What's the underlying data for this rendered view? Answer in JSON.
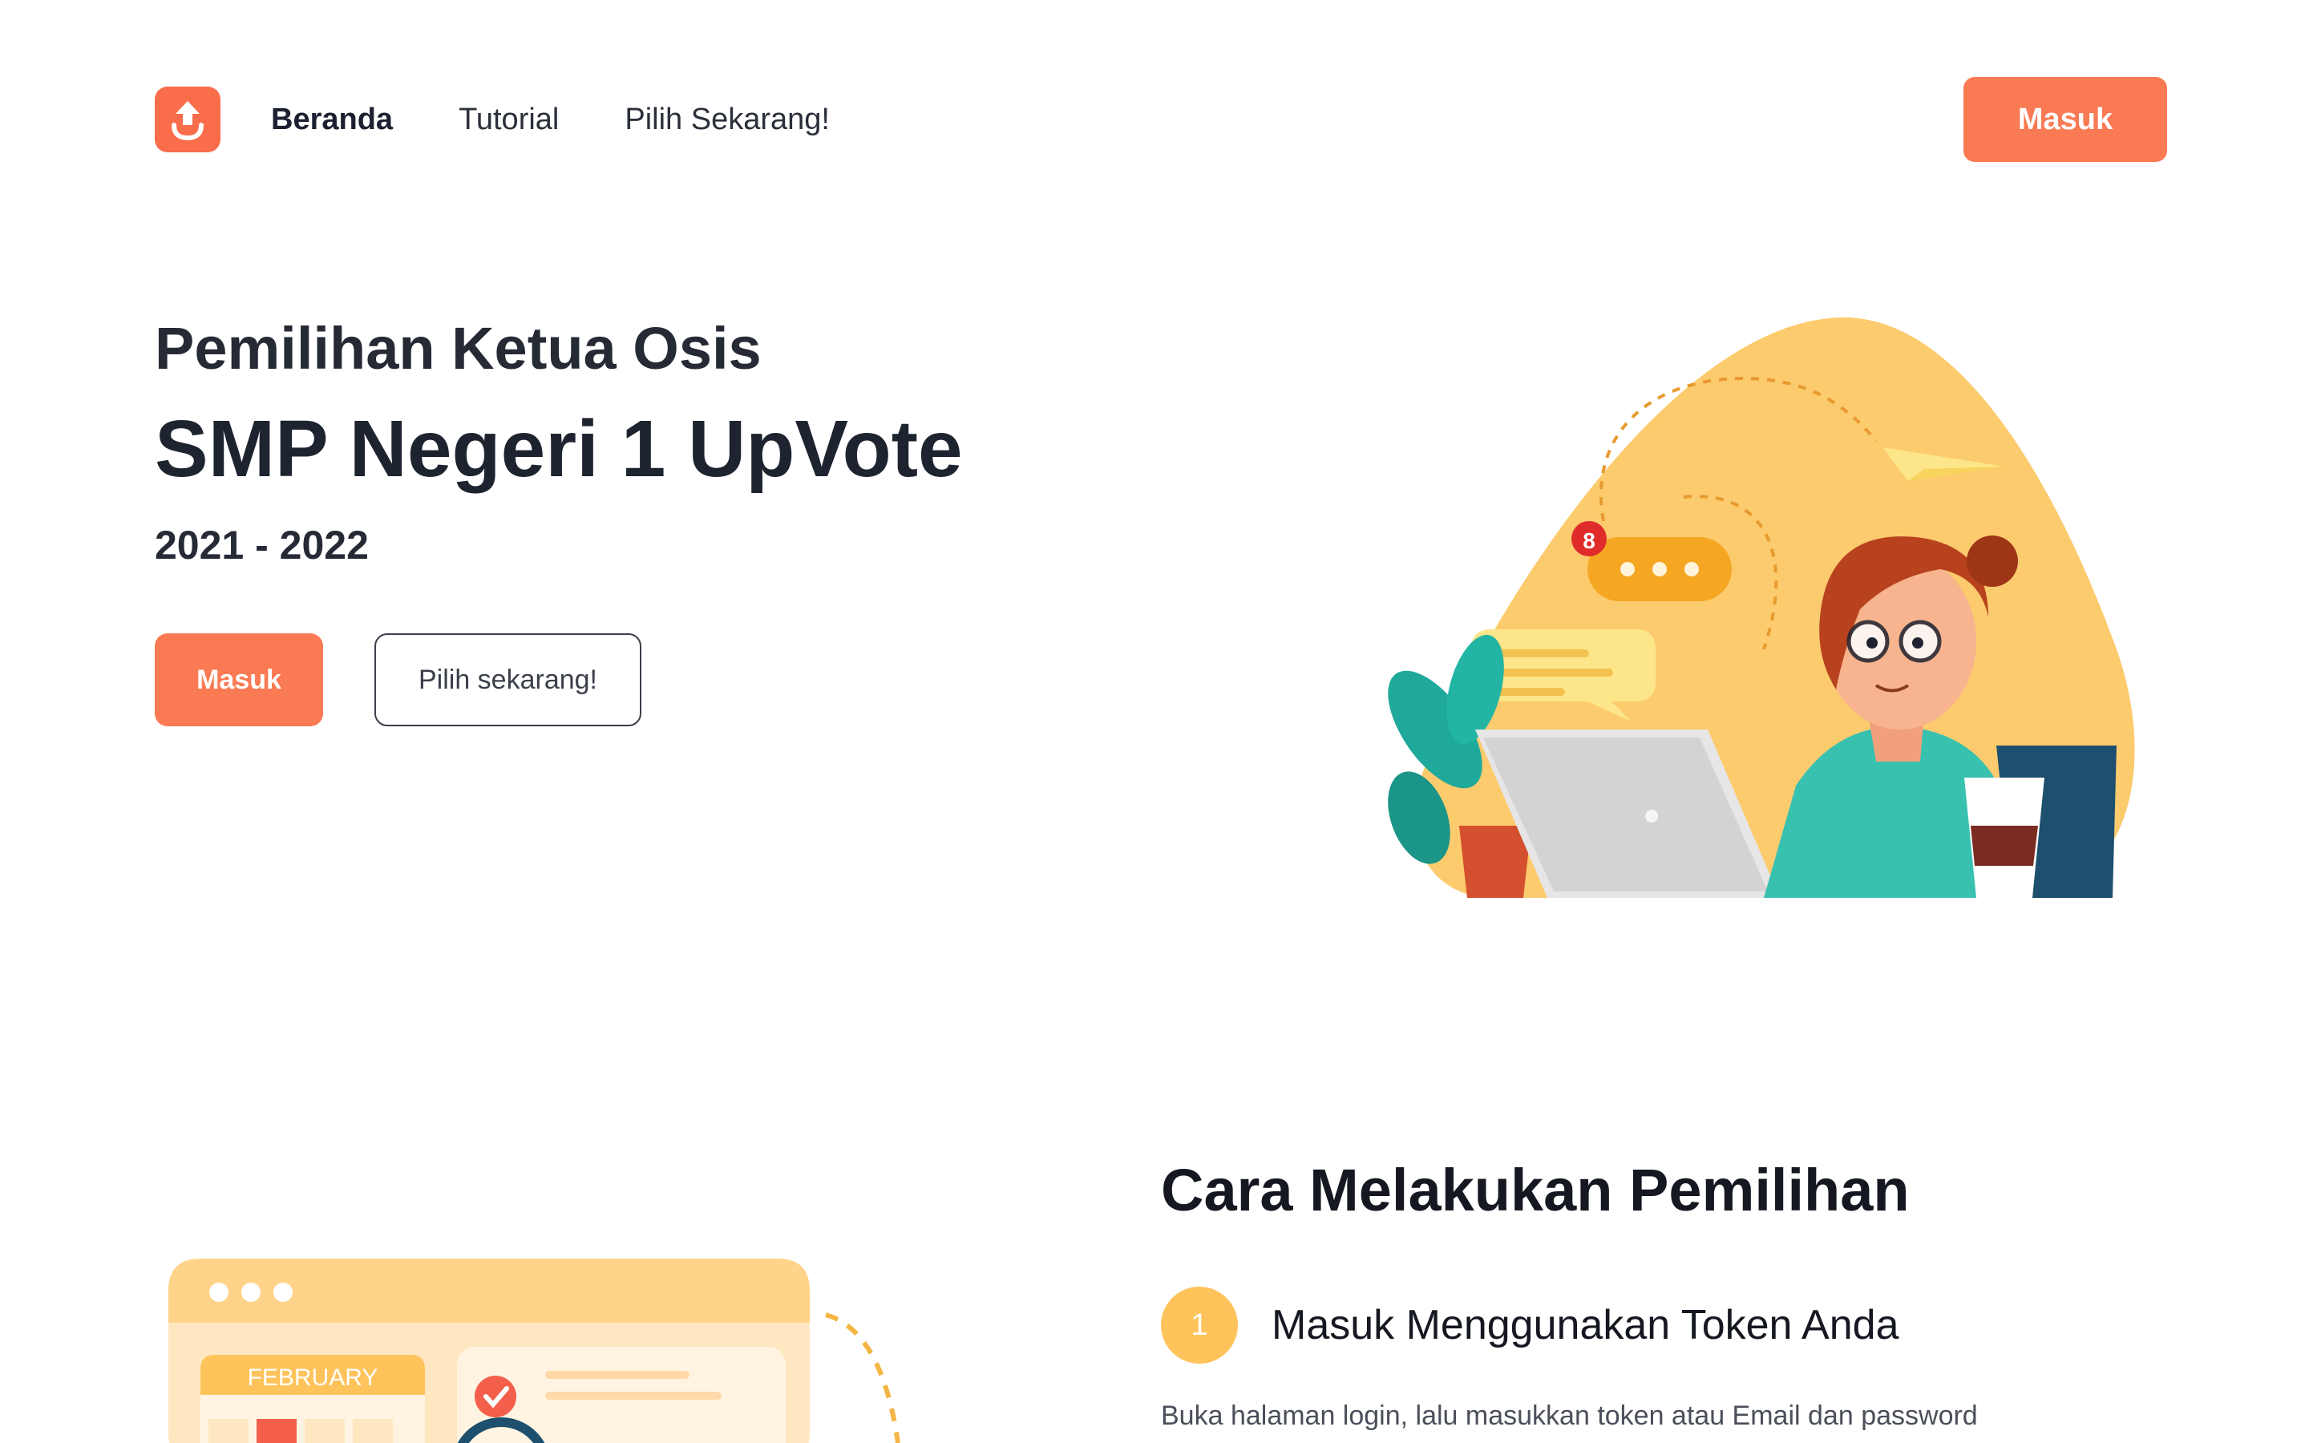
{
  "nav": {
    "links": [
      {
        "label": "Beranda"
      },
      {
        "label": "Tutorial"
      },
      {
        "label": "Pilih Sekarang!"
      }
    ],
    "login_label": "Masuk"
  },
  "hero": {
    "subtitle": "Pemilihan Ketua Osis",
    "title": "SMP Negeri 1 UpVote",
    "year": "2021 - 2022",
    "primary_button": "Masuk",
    "secondary_button": "Pilih sekarang!",
    "notification_count": "8"
  },
  "tutorial": {
    "title": "Cara Melakukan Pemilihan",
    "calendar_month": "FEBRUARY",
    "steps": [
      {
        "number": "1",
        "title": "Masuk Menggunakan Token Anda",
        "description": "Buka halaman login, lalu masukkan token atau Email dan password"
      }
    ]
  },
  "colors": {
    "accent": "#fa7a53",
    "step_badge": "#ffc35c",
    "illustration_blob": "#fccb6e"
  }
}
